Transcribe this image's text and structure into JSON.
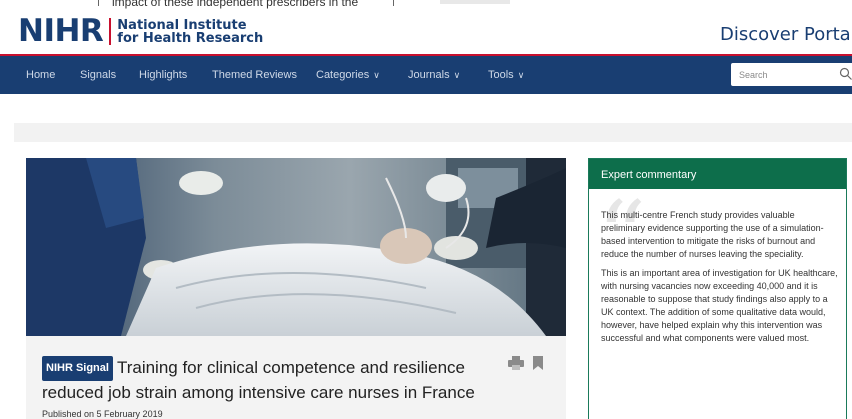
{
  "header": {
    "bleed_text": "impact of these independent prescribers in the",
    "logo_mark": "NIHR",
    "logo_line1": "National Institute",
    "logo_line2": "for Health Research",
    "portal_title": "Discover Portal"
  },
  "nav": {
    "items": [
      {
        "label": "Home"
      },
      {
        "label": "Signals"
      },
      {
        "label": "Highlights"
      },
      {
        "label": "Themed Reviews"
      },
      {
        "label": "Categories",
        "dropdown": true
      },
      {
        "label": "Journals",
        "dropdown": true
      },
      {
        "label": "Tools",
        "dropdown": true
      }
    ],
    "chevron": "∨",
    "search_placeholder": "Search"
  },
  "article": {
    "badge": "NIHR Signal",
    "title": "Training for clinical competence and resilience reduced job strain among intensive care nurses in France",
    "published": "Published on 5 February 2019",
    "icons": [
      "print-icon",
      "bookmark-icon"
    ]
  },
  "commentary": {
    "heading": "Expert commentary",
    "paragraphs": [
      "This multi-centre French study provides valuable preliminary evidence supporting the use of a simulation-based intervention to mitigate the risks of burnout and reduce the number of nurses leaving the speciality.",
      "This is an important area of investigation for UK healthcare, with nursing vacancies now exceeding 40,000 and it is reasonable to suppose that study findings also apply to a UK context. The addition of some qualitative data would, however, have helped explain why this intervention was successful and what components were valued most."
    ]
  },
  "colors": {
    "brand_navy": "#193e72",
    "brand_red": "#c8102e",
    "commentary_green": "#0d6e4b"
  }
}
